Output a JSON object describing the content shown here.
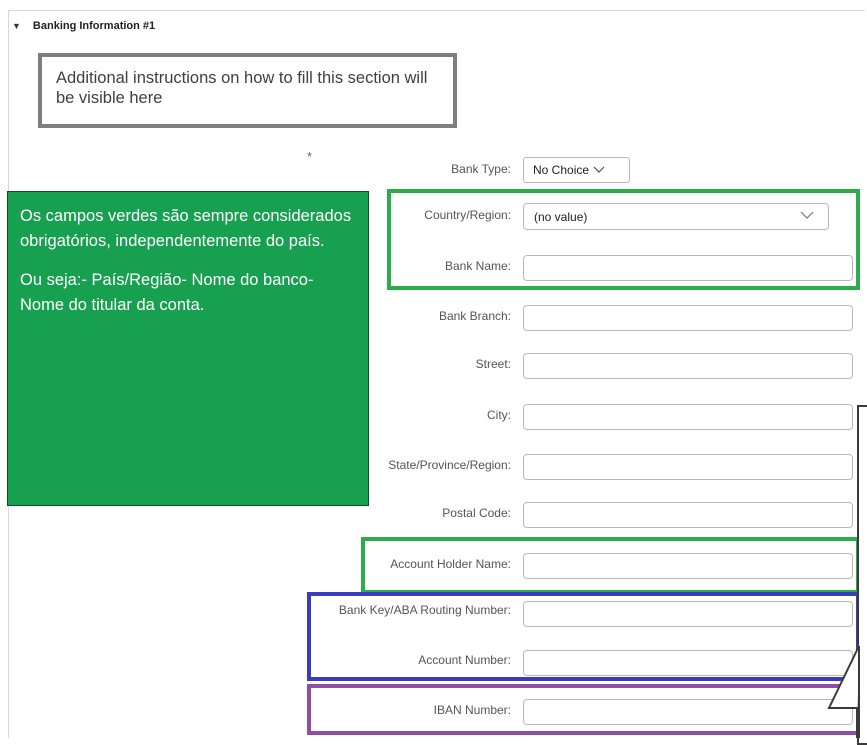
{
  "section": {
    "title": "Banking Information #1",
    "caret_icon": "▼"
  },
  "instructions": "Additional instructions on how to fill this section will be visible here",
  "required_marker": "*",
  "fields": {
    "bank_type": {
      "label": "Bank Type:",
      "value": "No Choice"
    },
    "country_region": {
      "label": "Country/Region:",
      "value": "(no value)"
    },
    "bank_name": {
      "label": "Bank Name:",
      "value": ""
    },
    "bank_branch": {
      "label": "Bank Branch:",
      "value": ""
    },
    "street": {
      "label": "Street:",
      "value": ""
    },
    "city": {
      "label": "City:",
      "value": ""
    },
    "state": {
      "label": "State/Province/Region:",
      "value": ""
    },
    "postal_code": {
      "label": "Postal Code:",
      "value": ""
    },
    "account_holder": {
      "label": "Account Holder Name:",
      "value": ""
    },
    "bank_key": {
      "label": "Bank Key/ABA Routing Number:",
      "value": ""
    },
    "account_number": {
      "label": "Account Number:",
      "value": ""
    },
    "iban": {
      "label": "IBAN Number:",
      "value": ""
    }
  },
  "annotation": {
    "paragraph1": "Os campos verdes são sempre considerados obrigatórios, independentemente do país.",
    "paragraph2": "Ou seja:- País/Região- Nome do banco- Nome do titular da conta."
  },
  "colors": {
    "green_fill": "#17a050",
    "green_outline": "#2bae4a",
    "blue_outline": "#3a3bbf",
    "purple_outline": "#8e4ea6",
    "gray_outline": "#7f7f7f"
  }
}
